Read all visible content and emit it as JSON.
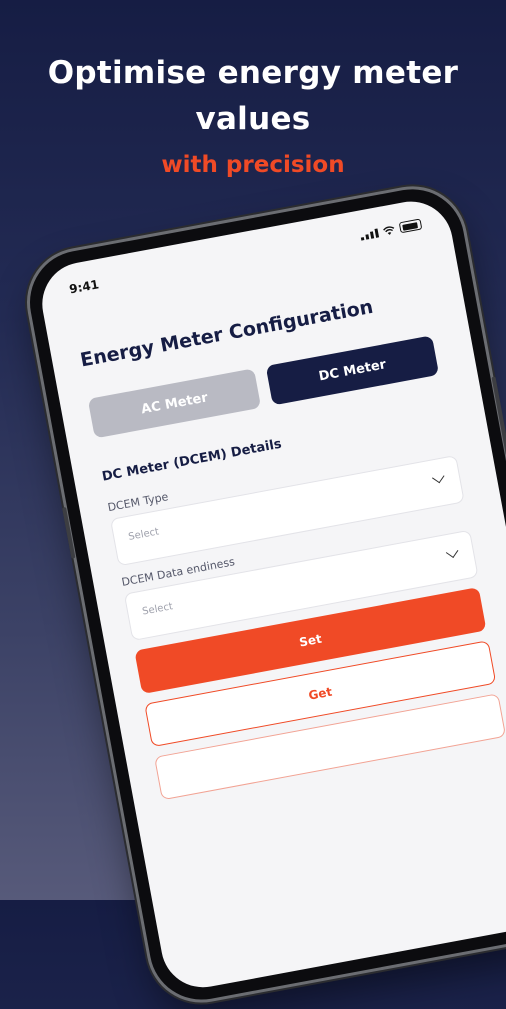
{
  "hero": {
    "title": "Optimise energy meter values",
    "subtitle": "with precision"
  },
  "status_bar": {
    "time": "9:41",
    "icons": [
      "signal-icon",
      "wifi-icon",
      "battery-icon"
    ]
  },
  "screen": {
    "title": "Energy Meter Configuration",
    "segmented": {
      "ac_label": "AC Meter",
      "dc_label": "DC Meter",
      "selected": "DC Meter"
    },
    "section_title": "DC Meter (DCEM) Details",
    "fields": [
      {
        "label": "DCEM Type",
        "placeholder": "Select"
      },
      {
        "label": "DCEM Data endiness",
        "placeholder": "Select"
      }
    ],
    "buttons": {
      "set_label": "Set",
      "get_label": "Get"
    }
  },
  "colors": {
    "accent": "#f04a26",
    "navy": "#161d44",
    "inactive": "#b9bac3"
  }
}
